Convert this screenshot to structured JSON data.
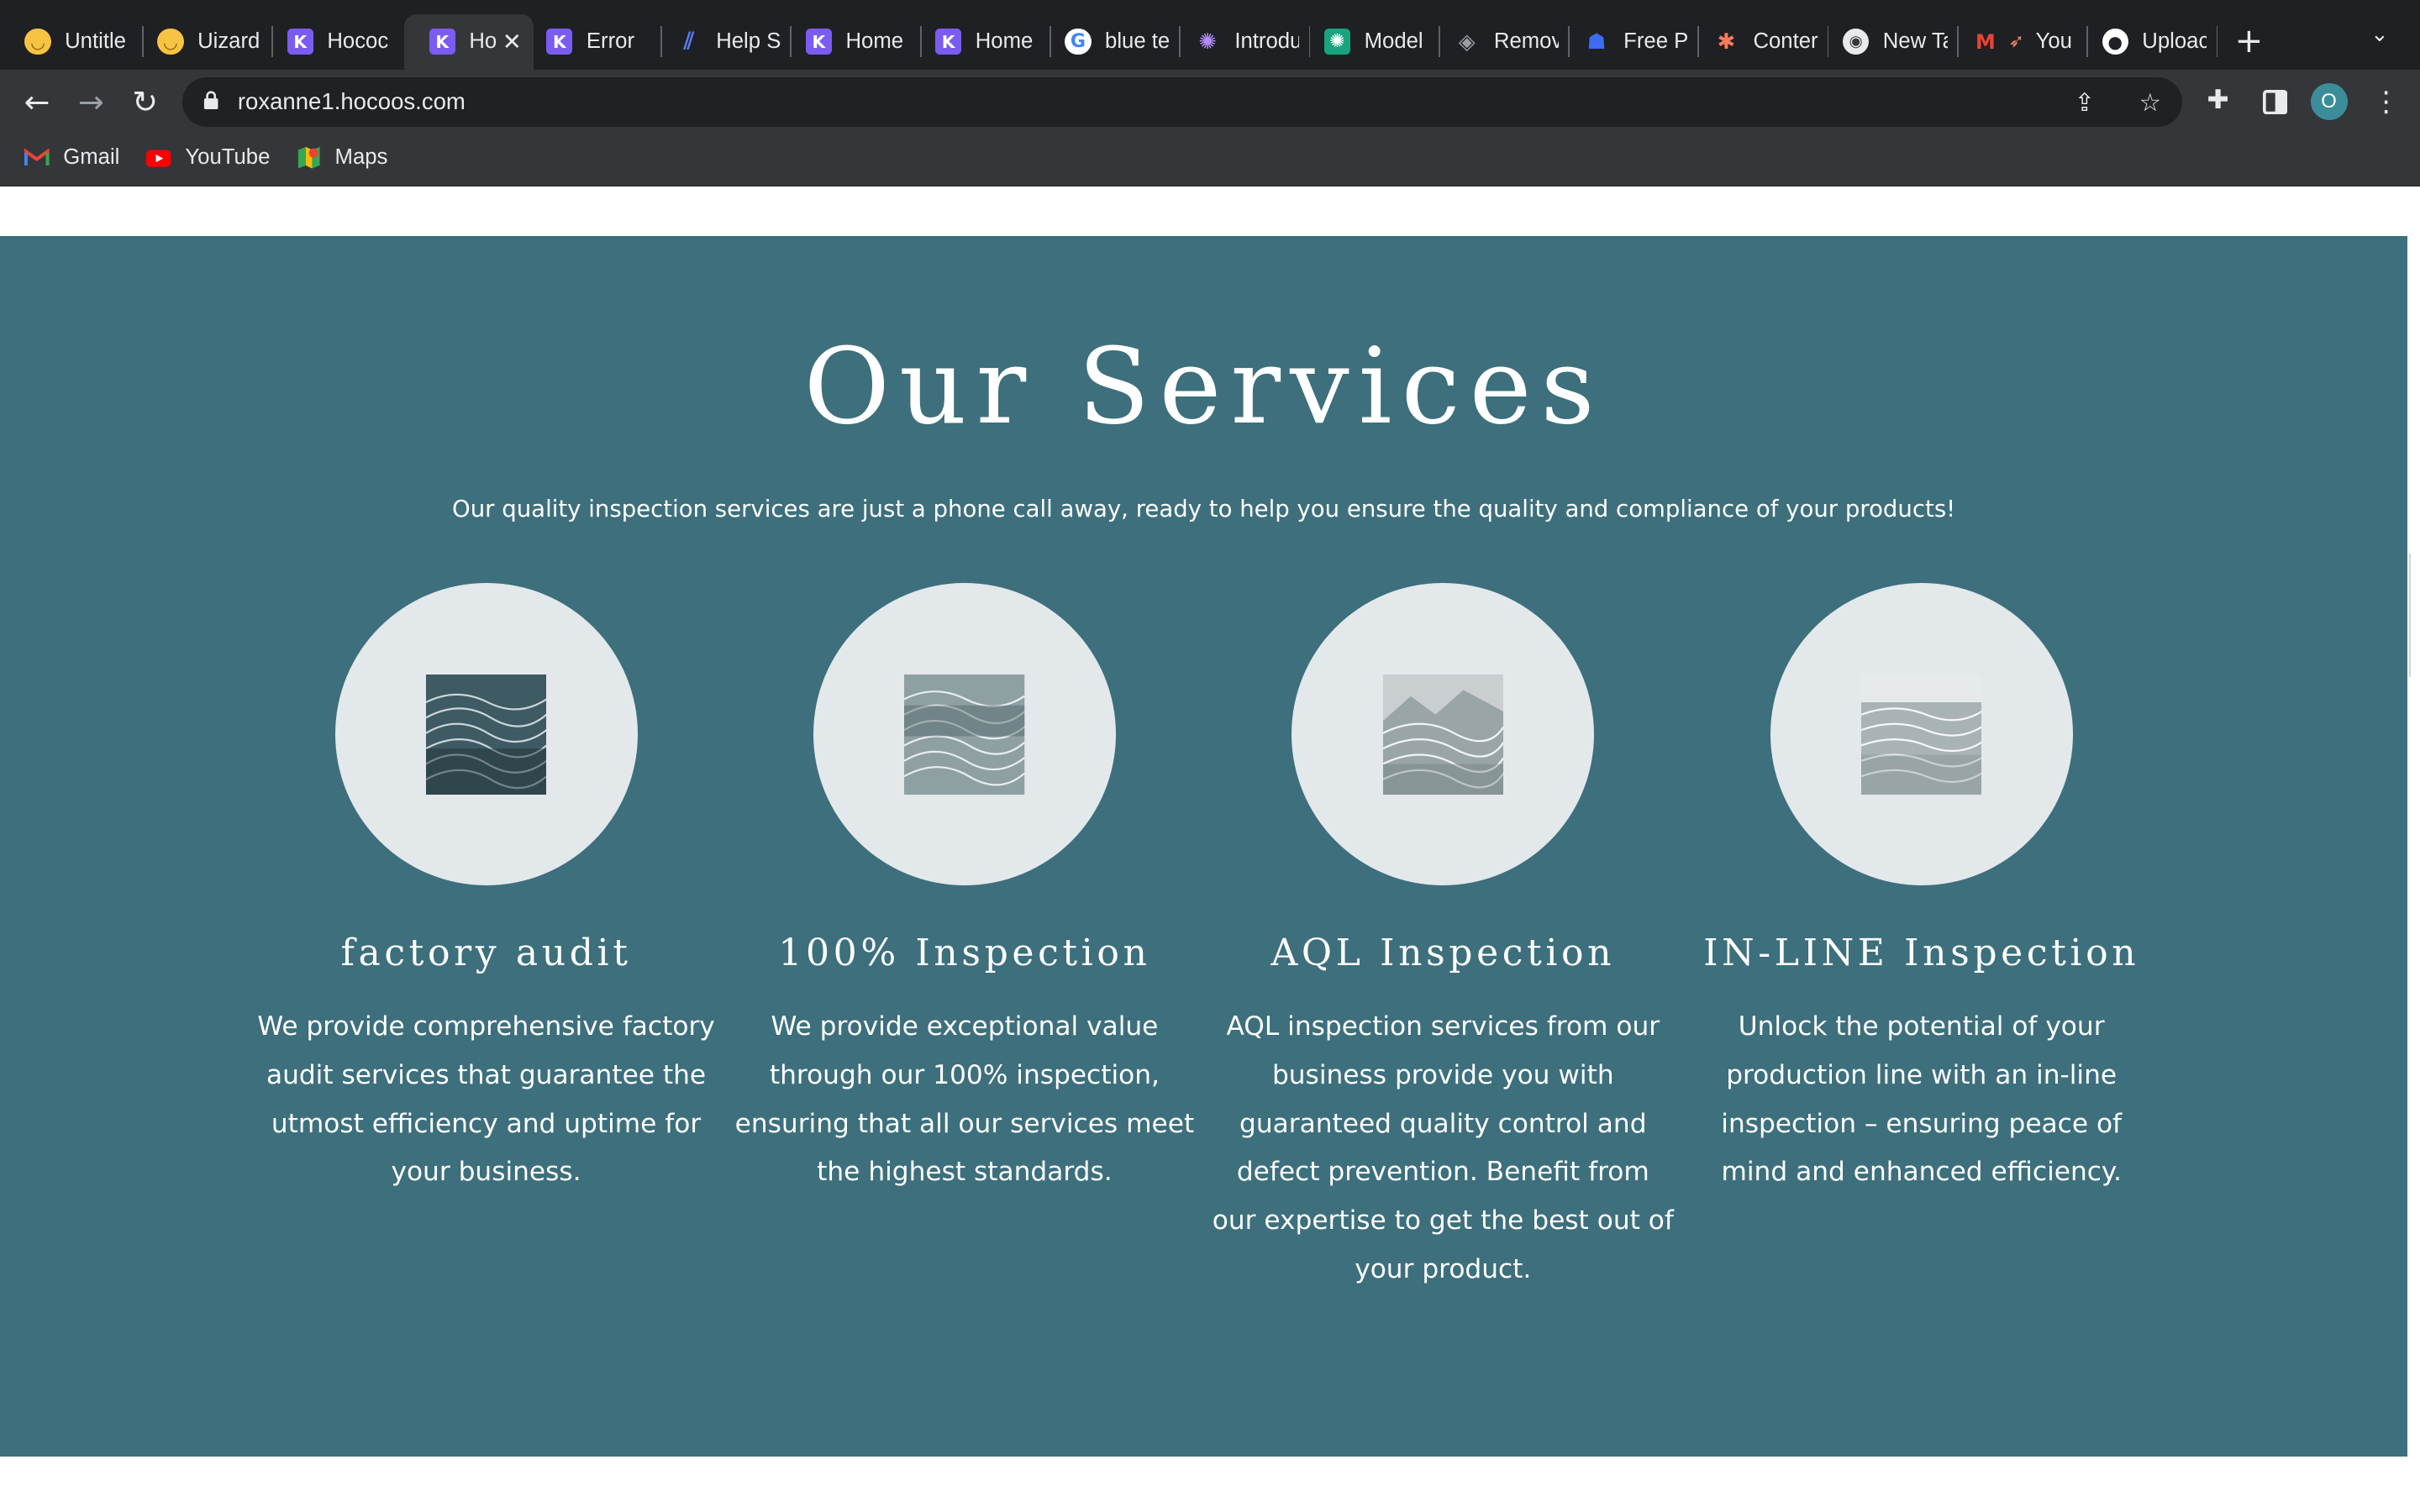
{
  "browser": {
    "tabs": [
      {
        "title": "Untitle",
        "icon": "yellow-smiley-icon",
        "color": "#f6c343"
      },
      {
        "title": "Uizard",
        "icon": "yellow-smiley-icon",
        "color": "#f6c343"
      },
      {
        "title": "Hococ",
        "icon": "hocoos-k-icon",
        "color": "#7b5cf0"
      },
      {
        "title": "Ho",
        "icon": "hocoos-k-icon",
        "color": "#7b5cf0",
        "active": true
      },
      {
        "title": "Error",
        "icon": "hocoos-k-icon",
        "color": "#7b5cf0"
      },
      {
        "title": "Help S",
        "icon": "linear-icon",
        "color": "#5b7cf7"
      },
      {
        "title": "Home",
        "icon": "hocoos-k-icon",
        "color": "#7b5cf0"
      },
      {
        "title": "Home",
        "icon": "hocoos-k-icon",
        "color": "#7b5cf0"
      },
      {
        "title": "blue te",
        "icon": "google-icon",
        "color": "#ffffff"
      },
      {
        "title": "Introdu",
        "icon": "openai-icon",
        "color": "#b18cff"
      },
      {
        "title": "Model",
        "icon": "openai-icon",
        "color": "#19a37f"
      },
      {
        "title": "Remov",
        "icon": "layers-icon",
        "color": "#9aa0a6"
      },
      {
        "title": "Free P",
        "icon": "pixel-robot-icon",
        "color": "#3c6df0"
      },
      {
        "title": "Conter",
        "icon": "hubspot-icon",
        "color": "#ff7a59"
      },
      {
        "title": "New Ta",
        "icon": "chrome-icon",
        "color": "#e8eaed"
      },
      {
        "title": "You",
        "icon": "gmail-rocket-icon",
        "color": "#ea4335"
      },
      {
        "title": "Uploac",
        "icon": "github-icon",
        "color": "#ffffff"
      }
    ],
    "url": "roxanne1.hocoos.com",
    "avatar_letter": "O",
    "bookmarks": [
      {
        "label": "Gmail",
        "icon": "gmail-icon"
      },
      {
        "label": "YouTube",
        "icon": "youtube-icon"
      },
      {
        "label": "Maps",
        "icon": "maps-icon"
      }
    ]
  },
  "page": {
    "bg_color": "#3d6f7d",
    "heading": "Our Services",
    "intro": "Our quality inspection services are just a phone call away, ready to help you ensure the quality and compliance of your products!",
    "services": [
      {
        "title": "factory audit",
        "desc": "We provide comprehensive factory audit services that guarantee the utmost efficiency and uptime for your business.",
        "image": "dark-waves-image"
      },
      {
        "title": "100% Inspection",
        "desc": "We provide exceptional value through our 100% inspection, ensuring that all our services meet the highest standards.",
        "image": "grey-waves-image"
      },
      {
        "title": "AQL Inspection",
        "desc": "AQL inspection services from our business provide you with guaranteed quality control and defect prevention. Benefit from our expertise to get the best out of your product.",
        "image": "mountain-lines-image"
      },
      {
        "title": "IN-LINE Inspection",
        "desc": "Unlock the potential of your production line with an in-line inspection – ensuring peace of mind and enhanced efficiency.",
        "image": "light-waves-image"
      }
    ]
  }
}
